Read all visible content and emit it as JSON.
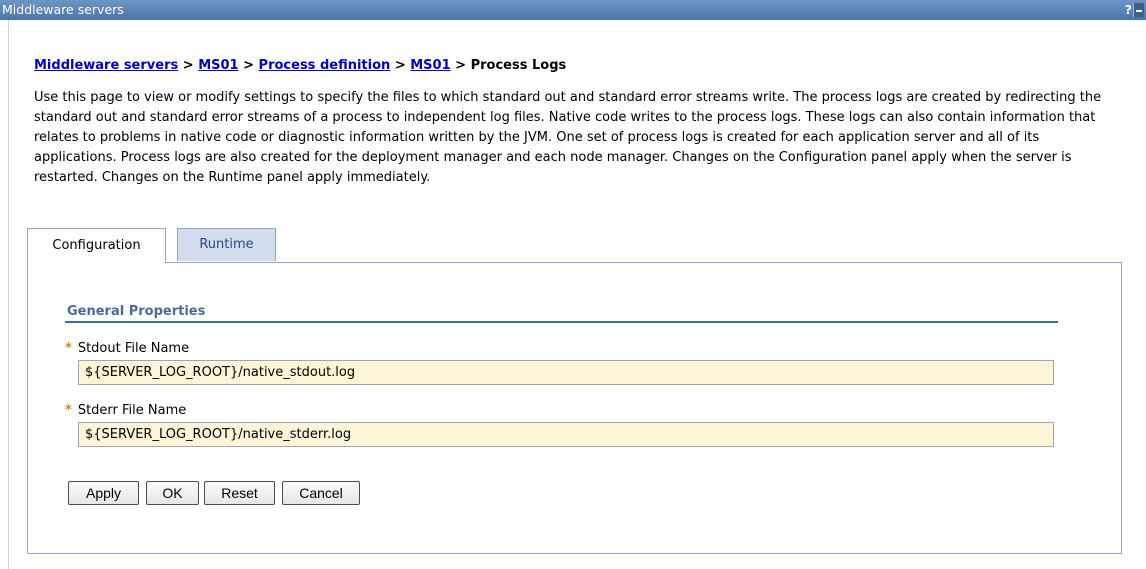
{
  "window": {
    "title": "Middleware servers",
    "help_label": "?"
  },
  "breadcrumb": {
    "items": [
      "Middleware servers",
      "MS01",
      "Process definition",
      "MS01"
    ],
    "separator": ">",
    "current": "Process Logs"
  },
  "description": "Use this page to view or modify settings to specify the files to which standard out and standard error streams write. The process logs are created by redirecting the standard out and standard error streams of a process to independent log files. Native code writes to the process logs. These logs can also contain information that relates to problems in native code or diagnostic information written by the JVM. One set of process logs is created for each application server and all of its applications. Process logs are also created for the deployment manager and each node manager. Changes on the Configuration panel apply when the server is restarted. Changes on the Runtime panel apply immediately.",
  "tabs": [
    {
      "label": "Configuration",
      "selected": true
    },
    {
      "label": "Runtime",
      "selected": false
    }
  ],
  "section": {
    "title": "General Properties"
  },
  "fields": {
    "required_marker": "*",
    "stdout": {
      "label": "Stdout File Name",
      "value": "${SERVER_LOG_ROOT}/native_stdout.log"
    },
    "stderr": {
      "label": "Stderr File Name",
      "value": "${SERVER_LOG_ROOT}/native_stderr.log"
    }
  },
  "buttons": {
    "apply": "Apply",
    "ok": "OK",
    "reset": "Reset",
    "cancel": "Cancel"
  },
  "colors": {
    "titlebar": "#5a80b4",
    "link": "#0000cc",
    "section_title": "#4a6b99",
    "input_background": "#fdf5d8",
    "required_marker": "#c5892b"
  }
}
